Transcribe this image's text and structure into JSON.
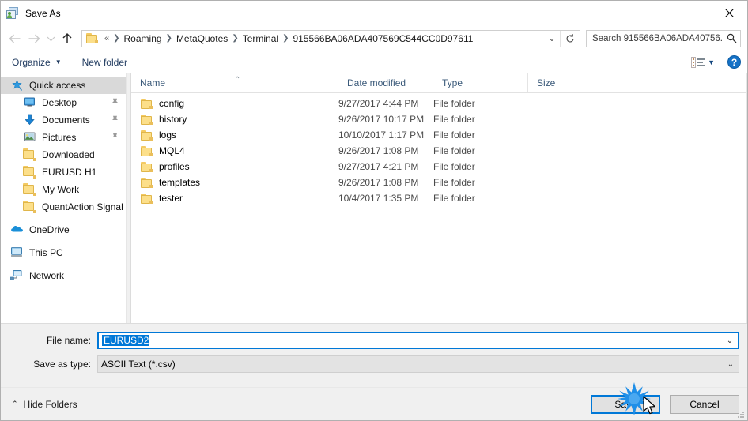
{
  "window": {
    "title": "Save As",
    "app_icon": "save-as-app-icon",
    "close_label": "✕"
  },
  "navigation": {
    "back": "back-arrow",
    "forward": "forward-arrow",
    "recent": "recent-locations-chevron",
    "up": "up-arrow",
    "breadcrumbs": [
      "«",
      "Roaming",
      "MetaQuotes",
      "Terminal",
      "915566BA06ADA407569C544CC0D97611"
    ],
    "separator": "❯",
    "dropdown": "⌄",
    "refresh": "↻"
  },
  "search": {
    "placeholder": "Search 915566BA06ADA40756...",
    "icon": "search-icon"
  },
  "commandbar": {
    "organize": "Organize",
    "organize_caret": "▼",
    "new_folder": "New folder",
    "view_caret": "▼",
    "help": "?"
  },
  "sidebar": {
    "items": [
      {
        "label": "Quick access",
        "icon": "star-pin-icon",
        "level": "root",
        "selected": true,
        "pinned": false
      },
      {
        "label": "Desktop",
        "icon": "desktop-icon",
        "level": "child",
        "selected": false,
        "pinned": true
      },
      {
        "label": "Documents",
        "icon": "documents-download-icon",
        "level": "child",
        "selected": false,
        "pinned": true
      },
      {
        "label": "Pictures",
        "icon": "pictures-icon",
        "level": "child",
        "selected": false,
        "pinned": true
      },
      {
        "label": "Downloaded",
        "icon": "folder-icon",
        "level": "child",
        "selected": false,
        "pinned": false
      },
      {
        "label": "EURUSD H1",
        "icon": "folder-icon",
        "level": "child",
        "selected": false,
        "pinned": false
      },
      {
        "label": "My Work",
        "icon": "folder-icon",
        "level": "child",
        "selected": false,
        "pinned": false
      },
      {
        "label": "QuantAction Signal",
        "icon": "folder-icon",
        "level": "child",
        "selected": false,
        "pinned": false
      },
      {
        "label": "OneDrive",
        "icon": "onedrive-cloud-icon",
        "level": "root",
        "selected": false,
        "pinned": false
      },
      {
        "label": "This PC",
        "icon": "this-pc-icon",
        "level": "root",
        "selected": false,
        "pinned": false
      },
      {
        "label": "Network",
        "icon": "network-icon",
        "level": "root",
        "selected": false,
        "pinned": false
      }
    ]
  },
  "filelist": {
    "columns": [
      "Name",
      "Date modified",
      "Type",
      "Size"
    ],
    "sort_indicator": "⌃",
    "rows": [
      {
        "name": "config",
        "date": "9/27/2017 4:44 PM",
        "type": "File folder",
        "size": ""
      },
      {
        "name": "history",
        "date": "9/26/2017 10:17 PM",
        "type": "File folder",
        "size": ""
      },
      {
        "name": "logs",
        "date": "10/10/2017 1:17 PM",
        "type": "File folder",
        "size": ""
      },
      {
        "name": "MQL4",
        "date": "9/26/2017 1:08 PM",
        "type": "File folder",
        "size": ""
      },
      {
        "name": "profiles",
        "date": "9/27/2017 4:21 PM",
        "type": "File folder",
        "size": ""
      },
      {
        "name": "templates",
        "date": "9/26/2017 1:08 PM",
        "type": "File folder",
        "size": ""
      },
      {
        "name": "tester",
        "date": "10/4/2017 1:35 PM",
        "type": "File folder",
        "size": ""
      }
    ]
  },
  "form": {
    "filename_label": "File name:",
    "filename_value": "EURUSD2",
    "filetype_label": "Save as type:",
    "filetype_value": "ASCII Text (*.csv)",
    "combo_arrow": "⌄"
  },
  "footer": {
    "hide_folders": "Hide Folders",
    "hide_folders_caret": "⌃",
    "save": "Save",
    "cancel": "Cancel"
  },
  "colors": {
    "accent": "#0078d7",
    "selection": "#0078d7",
    "sidebar_selected": "#d9d9d9",
    "chrome": "#f0f0f0",
    "header_text": "#3b5a7a",
    "command_text": "#1f3a5f",
    "folder_yellow": "#fcdf8a"
  }
}
